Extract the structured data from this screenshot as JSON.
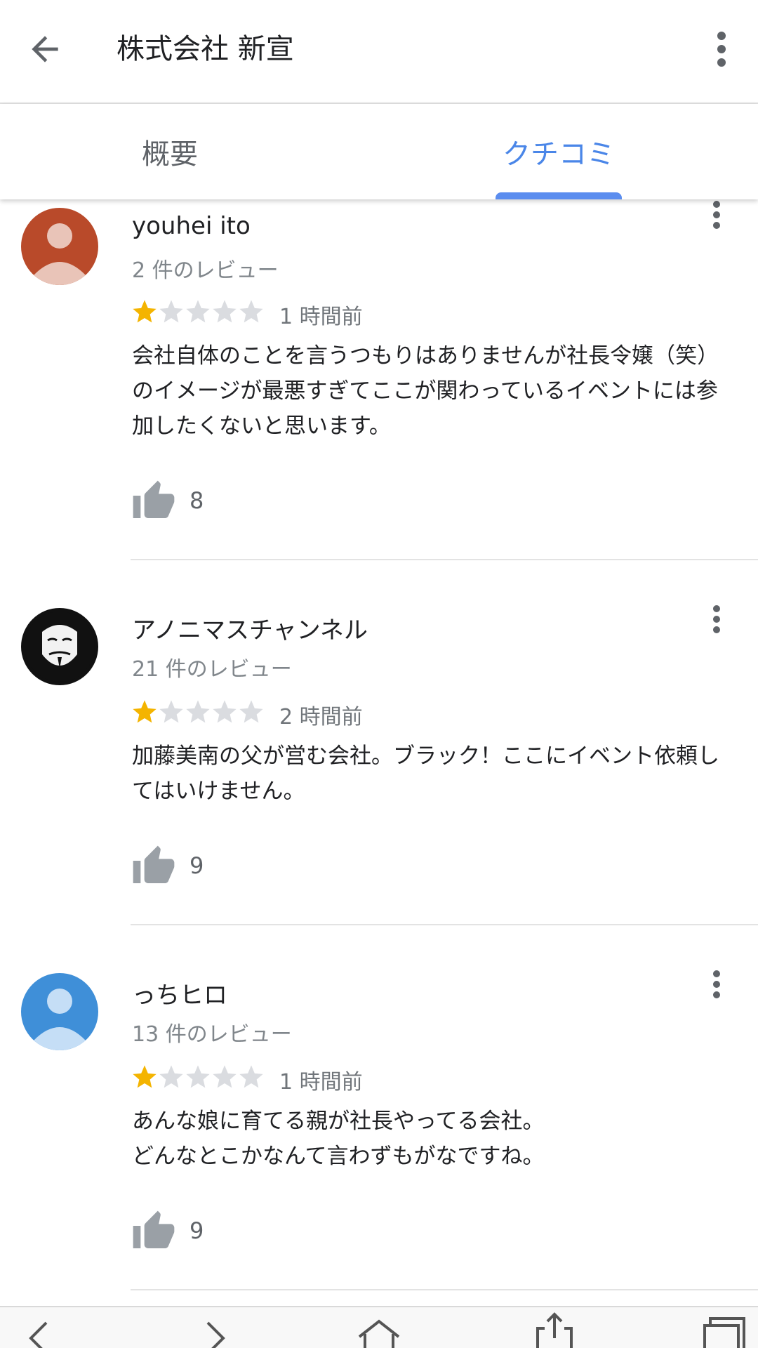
{
  "header": {
    "title": "株式会社 新宣",
    "back_icon": "arrow-left-icon",
    "more_icon": "more-vert-icon"
  },
  "tabs": [
    {
      "label": "概要",
      "active": false
    },
    {
      "label": "クチコミ",
      "active": true
    }
  ],
  "colors": {
    "accent": "#4a86e8",
    "star_filled": "#f4b400",
    "star_empty": "#dadce0"
  },
  "reviews": [
    {
      "author": "youhei ito",
      "review_count": "2 件のレビュー",
      "rating": 1,
      "time": "1 時間前",
      "text": "会社自体のことを言うつもりはありませんが社長令嬢（笑）のイメージが最悪すぎてここが関わっているイベントには参加したくないと思います。",
      "likes": "8",
      "avatar_color": "#b94a2a"
    },
    {
      "author": "アノニマスチャンネル",
      "review_count": "21 件のレビュー",
      "rating": 1,
      "time": "2 時間前",
      "text": "加藤美南の父が営む会社。ブラック！ここにイベント依頼してはいけません。",
      "likes": "9",
      "avatar_color": "#111111"
    },
    {
      "author": "っちヒロ",
      "review_count": "13 件のレビュー",
      "rating": 1,
      "time": "1 時間前",
      "text": "あんな娘に育てる親が社長やってる会社。\nどんなとこかなんて言わずもがなですね。",
      "likes": "9",
      "avatar_color": "#3f8fd8"
    }
  ],
  "bottom_nav": [
    "back-icon",
    "forward-icon",
    "home-icon",
    "share-icon",
    "tabs-icon"
  ]
}
